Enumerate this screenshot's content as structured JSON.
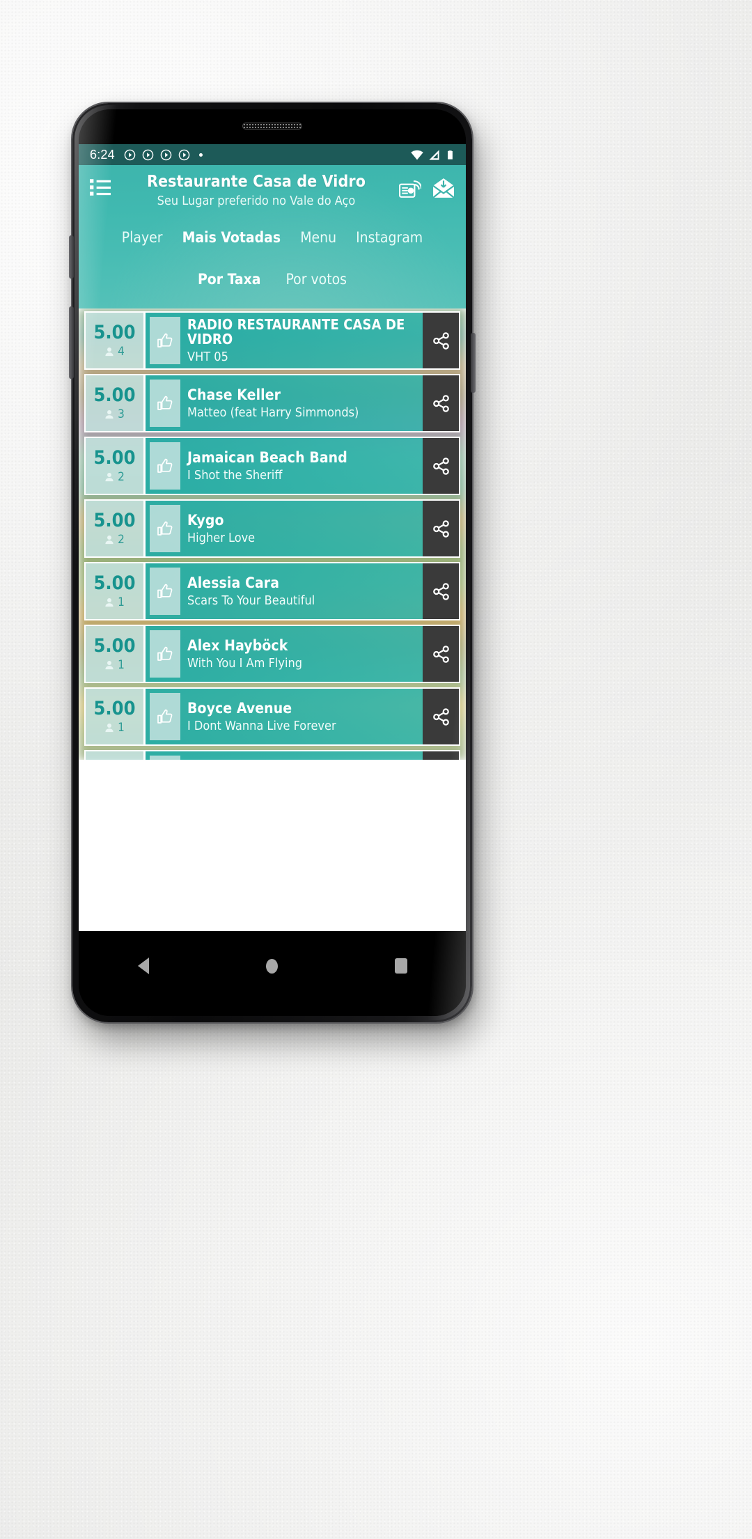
{
  "colors": {
    "teal_primary": "#3cb3ab",
    "teal_dark_status": "#1d5a58",
    "rate_text": "#17938e",
    "card_body": "#23aca5",
    "share_bg": "#3a3a3a",
    "rate_col_bg": "#c3e1de"
  },
  "statusbar": {
    "time": "6:24",
    "play_icons": [
      "play-circle-icon",
      "play-circle-icon",
      "play-circle-icon",
      "play-circle-icon"
    ],
    "dot_icon": "dot-indicator-icon",
    "right_icons": [
      "wifi-icon",
      "cellular-signal-icon",
      "battery-icon"
    ]
  },
  "header": {
    "menu_icon": "list-menu-icon",
    "title": "Restaurante Casa de Vidro",
    "subtitle": "Seu Lugar preferido no Vale do Aço",
    "actions": [
      {
        "icon": "radio-icon",
        "label": "Radio"
      },
      {
        "icon": "envelope-icon",
        "label": "Mensagens"
      }
    ]
  },
  "tabs": [
    {
      "label": "Player",
      "active": false
    },
    {
      "label": "Mais Votadas",
      "active": true
    },
    {
      "label": "Menu",
      "active": false
    },
    {
      "label": "Instagram",
      "active": false
    }
  ],
  "subtabs": [
    {
      "label": "Por Taxa",
      "active": true
    },
    {
      "label": "Por votos",
      "active": false
    }
  ],
  "list": {
    "vote_icon": "person-icon",
    "like_icon": "thumbs-up-icon",
    "share_icon": "share-icon",
    "items": [
      {
        "rating": "5.00",
        "votes": "4",
        "title": "RADIO RESTAURANTE CASA DE VIDRO",
        "subtitle": "VHT 05"
      },
      {
        "rating": "5.00",
        "votes": "3",
        "title": "Chase Keller",
        "subtitle": "Matteo (feat Harry Simmonds)"
      },
      {
        "rating": "5.00",
        "votes": "2",
        "title": "Jamaican Beach Band",
        "subtitle": "I Shot the Sheriff"
      },
      {
        "rating": "5.00",
        "votes": "2",
        "title": "Kygo",
        "subtitle": "Higher Love"
      },
      {
        "rating": "5.00",
        "votes": "1",
        "title": "Alessia Cara",
        "subtitle": "Scars To Your Beautiful"
      },
      {
        "rating": "5.00",
        "votes": "1",
        "title": "Alex Hayböck",
        "subtitle": "With You I Am Flying"
      },
      {
        "rating": "5.00",
        "votes": "1",
        "title": "Boyce Avenue",
        "subtitle": "I Dont Wanna Live Forever"
      }
    ]
  },
  "navbar": {
    "back": "back-nav-icon",
    "home": "home-nav-icon",
    "recent": "recent-apps-nav-icon"
  }
}
